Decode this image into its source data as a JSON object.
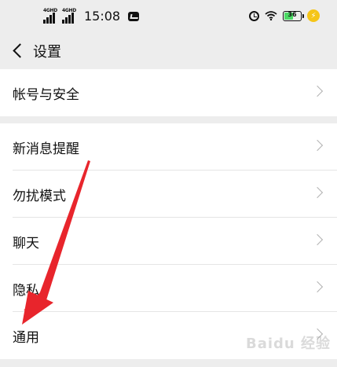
{
  "status_bar": {
    "signal1": "4GHD",
    "signal2": "4GHD",
    "time": "15:08",
    "battery_level": "36"
  },
  "nav": {
    "title": "设置"
  },
  "groups": [
    {
      "items": [
        {
          "label": "帐号与安全"
        }
      ]
    },
    {
      "items": [
        {
          "label": "新消息提醒"
        },
        {
          "label": "勿扰模式"
        },
        {
          "label": "聊天"
        },
        {
          "label": "隐私"
        },
        {
          "label": "通用"
        }
      ]
    }
  ],
  "watermark": "Baidu 经验",
  "colors": {
    "background": "#ededed",
    "row_bg": "#ffffff",
    "arrow": "#e8252c",
    "battery_fill": "#4cd964",
    "charge": "#f5c518"
  }
}
